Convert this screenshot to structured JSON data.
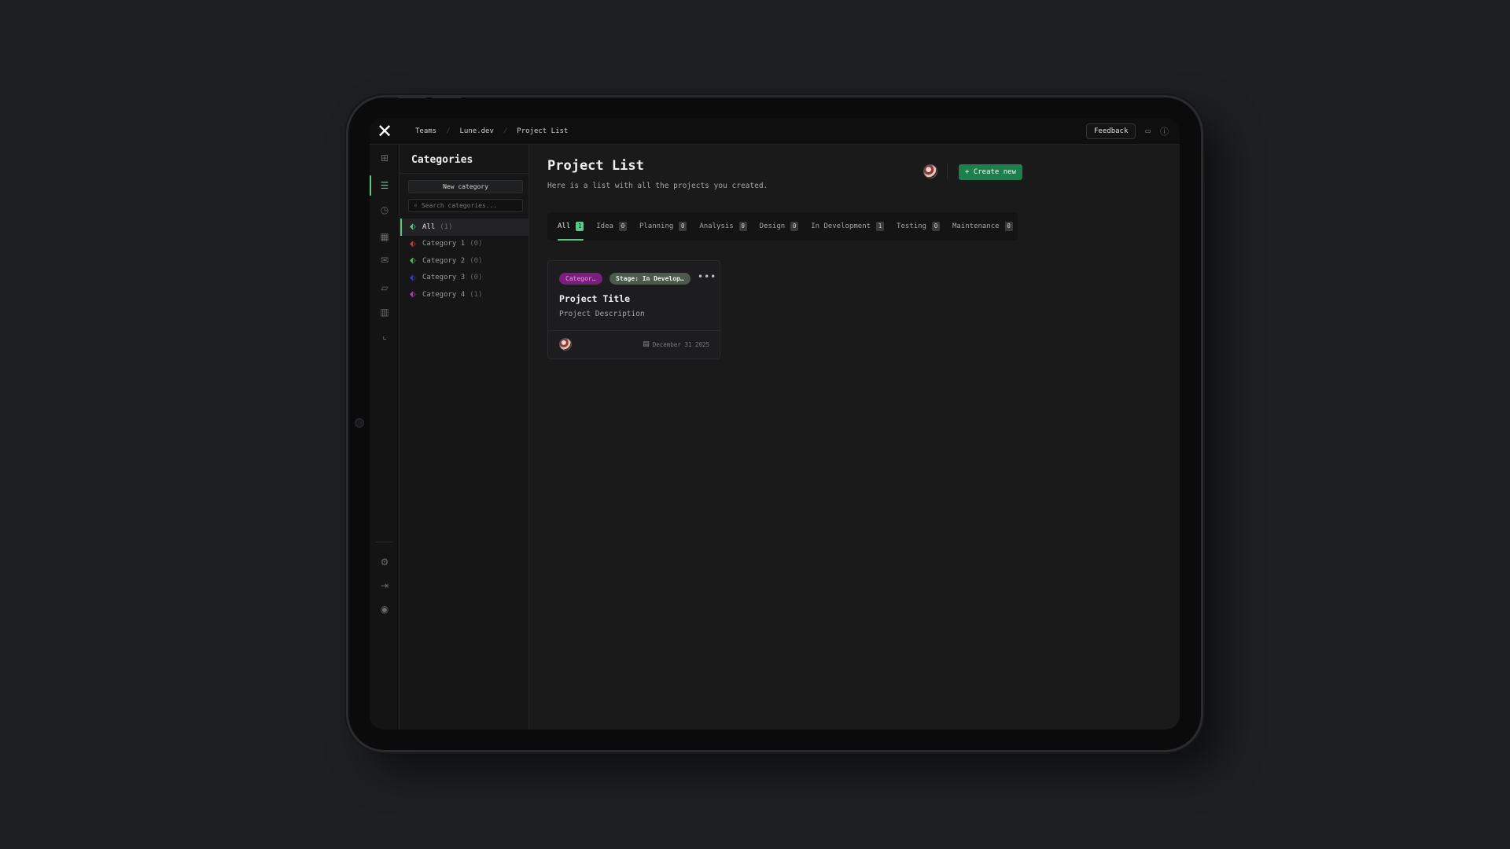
{
  "topbar": {
    "logo": "✕",
    "breadcrumbs": [
      "Teams",
      "Lune.dev",
      "Project List"
    ],
    "feedback_label": "Feedback"
  },
  "rail": {
    "icons": [
      "dashboard-icon",
      "list-icon",
      "history-icon",
      "calendar-icon",
      "mail-icon",
      "folder-icon",
      "bar-chart-icon",
      "line-chart-icon",
      "settings-icon",
      "logout-icon",
      "user-circle-icon"
    ],
    "active": "list-icon"
  },
  "categories": {
    "title": "Categories",
    "new_button": "New category",
    "search_placeholder": "Search categories...",
    "items": [
      {
        "name": "All",
        "count": "(1)",
        "color": "#58c98b",
        "selected": true
      },
      {
        "name": "Category 1",
        "count": "(0)",
        "color": "#d13b3b",
        "selected": false
      },
      {
        "name": "Category 2",
        "count": "(0)",
        "color": "#4fbf5a",
        "selected": false
      },
      {
        "name": "Category 3",
        "count": "(0)",
        "color": "#2f45c9",
        "selected": false
      },
      {
        "name": "Category 4",
        "count": "(1)",
        "color": "#c23ac4",
        "selected": false
      }
    ]
  },
  "main": {
    "title": "Project List",
    "subtitle": "Here is a list with all the projects you created.",
    "create_button": "+ Create new",
    "tabs": [
      {
        "label": "All",
        "count": "1",
        "active": true
      },
      {
        "label": "Idea",
        "count": "0",
        "active": false
      },
      {
        "label": "Planning",
        "count": "0",
        "active": false
      },
      {
        "label": "Analysis",
        "count": "0",
        "active": false
      },
      {
        "label": "Design",
        "count": "0",
        "active": false
      },
      {
        "label": "In Development",
        "count": "1",
        "active": false
      },
      {
        "label": "Testing",
        "count": "0",
        "active": false
      },
      {
        "label": "Maintenance",
        "count": "0",
        "active": false
      }
    ],
    "card": {
      "category_pill": "Categor…",
      "stage_pill": "Stage: In Develop…",
      "menu": "•••",
      "title": "Project Title",
      "description": "Project Description",
      "date": "December 31 2025"
    }
  },
  "colors": {
    "accent": "#58c98b",
    "create_button": "#1f7f4c",
    "category_pill": "#7a1f7b",
    "stage_pill": "#4b5a4d"
  }
}
